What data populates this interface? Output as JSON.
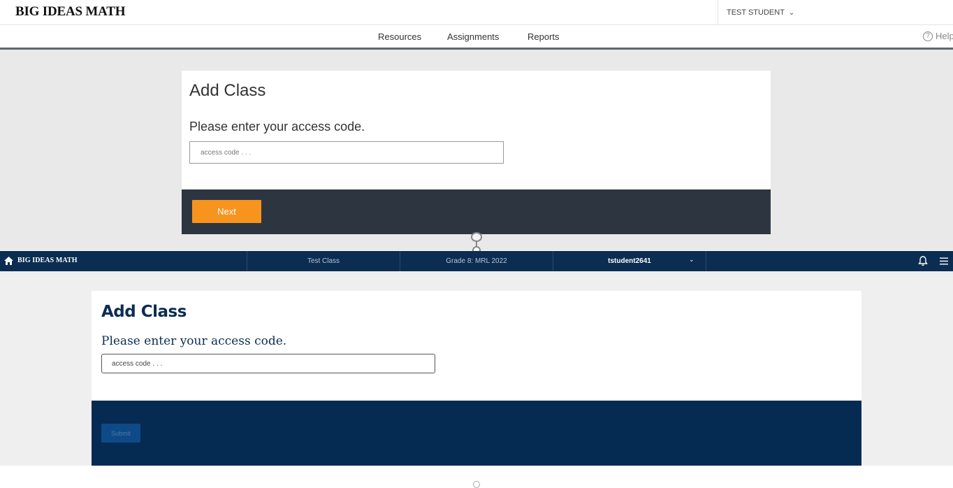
{
  "old_ui": {
    "logo": "BIG IDEAS MATH",
    "user_name": "TEST STUDENT",
    "nav": [
      "Resources",
      "Assignments",
      "Reports"
    ],
    "help": "Help",
    "card": {
      "title": "Add Class",
      "prompt": "Please enter your access code.",
      "input_placeholder": "access code . . .",
      "button": "Next"
    },
    "accent_color": "#f7941e"
  },
  "new_ui": {
    "logo": "BIG IDEAS MATH",
    "class_name": "Test Class",
    "course": "Grade 8: MRL 2022",
    "username": "tstudent2641",
    "card": {
      "title": "Add Class",
      "prompt": "Please enter your access code.",
      "input_placeholder": "access code . . .",
      "button": "Submit"
    },
    "brand_color": "#0b2d52"
  }
}
